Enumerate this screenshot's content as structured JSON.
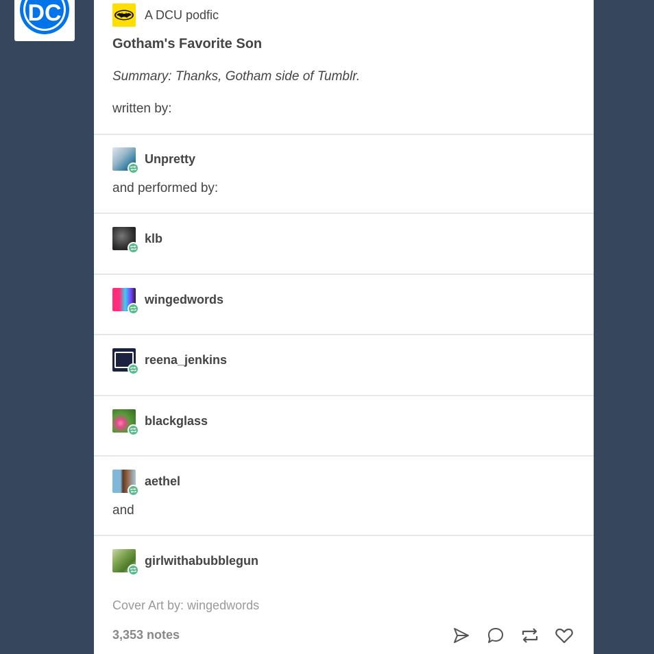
{
  "blog": {
    "logo_text": "DC",
    "source_label": "A DCU podfic"
  },
  "post": {
    "title": "Gotham's Favorite Son",
    "summary": "Summary: Thanks, Gotham side of Tumblr.",
    "written_by": "written by:",
    "performed_by": "and performed by:",
    "and_text": "and",
    "cover_art": "Cover Art by: wingedwords",
    "notes": "3,353 notes"
  },
  "reblogs": [
    {
      "username": "Unpretty",
      "avatar": "unpretty-avatar"
    },
    {
      "username": "klb",
      "avatar": "klb-avatar"
    },
    {
      "username": "wingedwords",
      "avatar": "wingedwords-avatar"
    },
    {
      "username": "reena_jenkins",
      "avatar": "podcast-avatar"
    },
    {
      "username": "blackglass",
      "avatar": "flower-avatar"
    },
    {
      "username": "aethel",
      "avatar": "aethel-avatar"
    },
    {
      "username": "girlwithabubblegun",
      "avatar": "girlwithabubblegun-avatar"
    }
  ],
  "actions": {
    "share_icon": "paper-plane-icon",
    "reply_icon": "speech-bubble-icon",
    "reblog_icon": "reblog-icon",
    "like_icon": "heart-icon"
  },
  "colors": {
    "background": "#36465d",
    "dc_blue": "#0074e8",
    "reblog_green": "#56bc8a",
    "batman_yellow": "#ffde00"
  }
}
